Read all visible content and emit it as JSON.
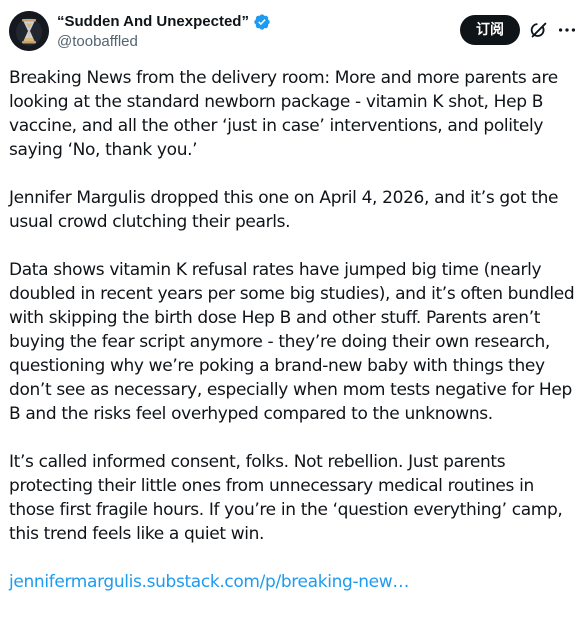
{
  "author": {
    "display_name": "“Sudden And Unexpected”",
    "handle": "@toobaffled",
    "avatar_icon": "hourglass-avatar",
    "verified_icon": "verified-badge-icon",
    "verified_color": "#1d9bf0"
  },
  "actions": {
    "subscribe_label": "订阅",
    "grok_icon": "grok-icon",
    "more_icon": "more-icon"
  },
  "post": {
    "paragraphs": [
      "Breaking News from the delivery room: More and more parents are looking at the standard newborn package - vitamin K shot, Hep B vaccine, and all the other ‘just in case’ interventions, and politely saying ‘No, thank you.’",
      "Jennifer Margulis dropped this one on April 4, 2026, and it’s got the usual crowd clutching their pearls.",
      "Data shows vitamin K refusal rates have jumped big time (nearly doubled in recent years per some big studies), and it’s often bundled with skipping the birth dose Hep B and other stuff. Parents aren’t buying the fear script anymore - they’re doing their own research, questioning why we’re poking a brand-new baby with things they don’t see as necessary, especially when mom tests negative for Hep B and the risks feel overhyped compared to the unknowns.",
      "It’s called informed consent, folks. Not rebellion. Just parents protecting their little ones from unnecessary medical routines in those first fragile hours. If you’re in the ‘question everything’ camp, this trend feels like a quiet win."
    ],
    "link_text": "jennifermargulis.substack.com/p/breaking-new…",
    "link_color": "#1d9bf0"
  }
}
